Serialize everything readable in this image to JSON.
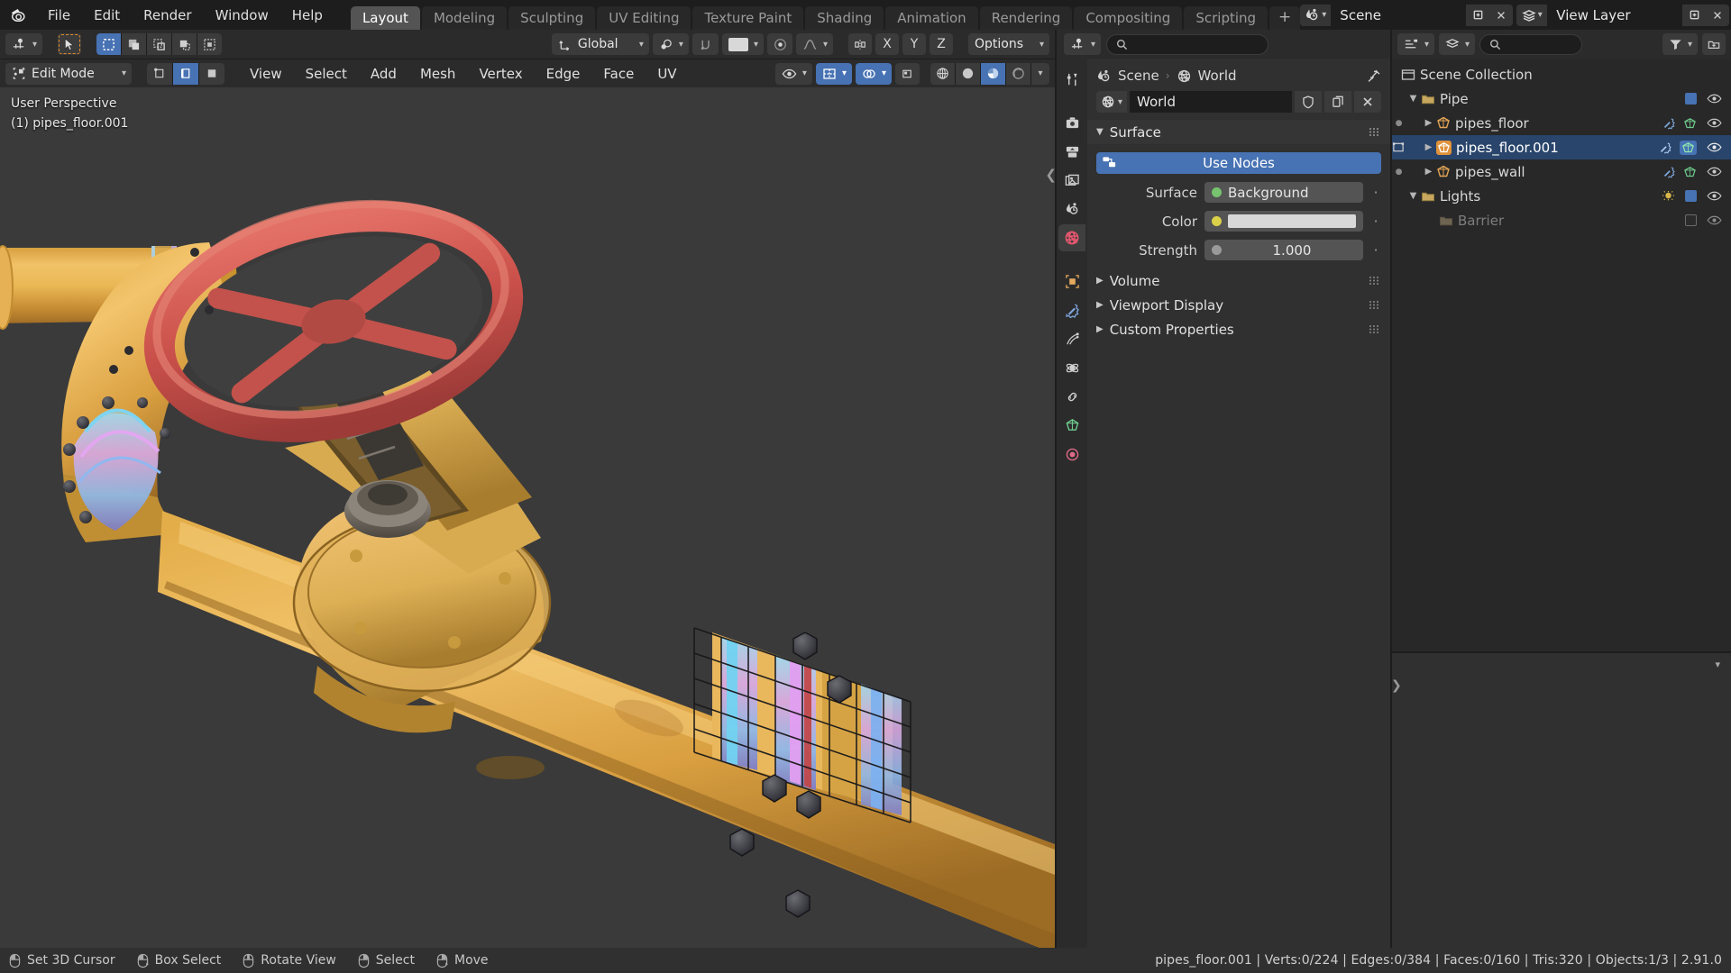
{
  "app": {
    "version_status": "pipes_floor.001 | Verts:0/224 | Edges:0/384 | Faces:0/160 | Tris:320 | Objects:1/3 | 2.91.0"
  },
  "topbar": {
    "menus": [
      "File",
      "Edit",
      "Render",
      "Window",
      "Help"
    ],
    "workspaces": [
      {
        "label": "Layout",
        "active": true
      },
      {
        "label": "Modeling",
        "active": false
      },
      {
        "label": "Sculpting",
        "active": false
      },
      {
        "label": "UV Editing",
        "active": false
      },
      {
        "label": "Texture Paint",
        "active": false
      },
      {
        "label": "Shading",
        "active": false
      },
      {
        "label": "Animation",
        "active": false
      },
      {
        "label": "Rendering",
        "active": false
      },
      {
        "label": "Compositing",
        "active": false
      },
      {
        "label": "Scripting",
        "active": false
      }
    ],
    "add_workspace": "+",
    "scene_name": "Scene",
    "viewlayer_name": "View Layer"
  },
  "viewport": {
    "header": {
      "transform_orientation": "Global",
      "mode": "Edit Mode",
      "menus": [
        "View",
        "Select",
        "Add",
        "Mesh",
        "Vertex",
        "Edge",
        "Face",
        "UV"
      ],
      "options_label": "Options",
      "axis_x": "X",
      "axis_y": "Y",
      "axis_z": "Z"
    },
    "overlay": {
      "perspective": "User Perspective",
      "active_object": "(1) pipes_floor.001"
    }
  },
  "properties": {
    "breadcrumb": {
      "scene": "Scene",
      "world": "World"
    },
    "datablock_name": "World",
    "panels": {
      "surface": "Surface",
      "volume": "Volume",
      "viewport_display": "Viewport Display",
      "custom_properties": "Custom Properties"
    },
    "use_nodes_label": "Use Nodes",
    "fields": [
      {
        "label": "Surface",
        "value": "Background",
        "type": "enum"
      },
      {
        "label": "Color",
        "value": "",
        "type": "color"
      },
      {
        "label": "Strength",
        "value": "1.000",
        "type": "number"
      }
    ],
    "tabs": [
      "tool-tab",
      "render-tab",
      "output-tab",
      "view-layer-tab",
      "scene-tab",
      "world-tab",
      "object-tab",
      "modifier-tab",
      "particles-tab",
      "physics-tab",
      "constraints-tab",
      "data-tab",
      "material-tab"
    ],
    "accent_color": "#4772b3",
    "world_tab_color": "#e8576f"
  },
  "outliner": {
    "root": "Scene Collection",
    "items": [
      {
        "name": "Pipe",
        "type": "collection",
        "depth": 0,
        "expanded": true,
        "checkbox": true,
        "visible": true
      },
      {
        "name": "pipes_floor",
        "type": "mesh",
        "depth": 1,
        "expanded": false,
        "visible": true,
        "selected": false
      },
      {
        "name": "pipes_floor.001",
        "type": "mesh",
        "depth": 1,
        "expanded": false,
        "visible": true,
        "selected": true
      },
      {
        "name": "pipes_wall",
        "type": "mesh",
        "depth": 1,
        "expanded": false,
        "visible": true,
        "selected": false
      },
      {
        "name": "Lights",
        "type": "collection",
        "depth": 0,
        "expanded": true,
        "checkbox": true,
        "visible": true
      },
      {
        "name": "Barrier",
        "type": "collection-hidden",
        "depth": 0,
        "expanded": false,
        "checkbox": false,
        "visible": true
      }
    ]
  },
  "statusbar": {
    "hints": [
      {
        "icon": "mouse-left",
        "label": "Set 3D Cursor"
      },
      {
        "icon": "mouse-left-drag",
        "label": "Box Select"
      },
      {
        "icon": "mouse-middle",
        "label": "Rotate View"
      },
      {
        "icon": "mouse-right",
        "label": "Select"
      },
      {
        "icon": "mouse-right-drag",
        "label": "Move"
      }
    ]
  }
}
